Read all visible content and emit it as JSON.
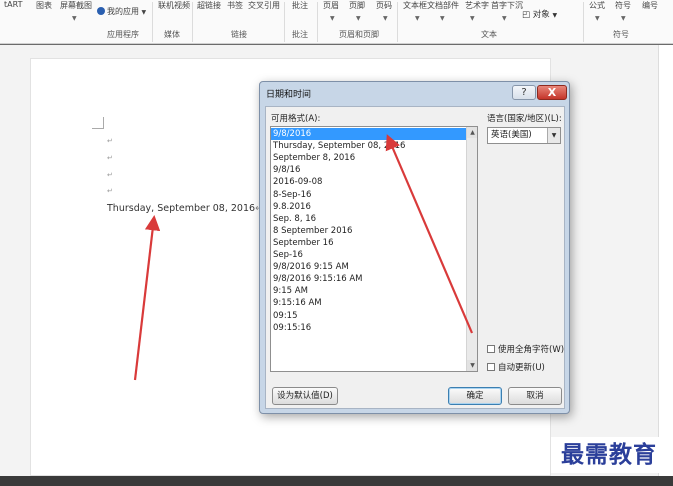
{
  "ribbon": {
    "top_items": [
      "tART",
      "图表",
      "屏幕截图",
      "我的应用",
      "联机视频",
      "超链接",
      "书签",
      "交叉引用",
      "批注",
      "页眉",
      "页脚",
      "页码",
      "文本框",
      "文档部件",
      "艺术字",
      "首字下沉",
      "公式",
      "符号",
      "编号"
    ],
    "object_label": "对象",
    "groups": [
      "应用程序",
      "媒体",
      "链接",
      "批注",
      "页眉和页脚",
      "文本",
      "符号"
    ]
  },
  "document": {
    "inserted_text": "Thursday, September 08, 2016"
  },
  "dialog": {
    "title": "日期和时间",
    "help_label": "?",
    "close_label": "X",
    "formats_label": "可用格式(A):",
    "formats": [
      "9/8/2016",
      "Thursday, September 08, 2016",
      "September 8, 2016",
      "9/8/16",
      "2016-09-08",
      "8-Sep-16",
      "9.8.2016",
      "Sep. 8, 16",
      "8 September 2016",
      "September 16",
      "Sep-16",
      "9/8/2016 9:15 AM",
      "9/8/2016 9:15:16 AM",
      "9:15 AM",
      "9:15:16 AM",
      "09:15",
      "09:15:16"
    ],
    "selected_index": 0,
    "language_label": "语言(国家/地区)(L):",
    "language_value": "英语(美国)",
    "fullwidth_label": "使用全角字符(W)",
    "autoupdate_label": "自动更新(U)",
    "set_default_label": "设为默认值(D)",
    "ok_label": "确定",
    "cancel_label": "取消"
  },
  "watermark": "最需教育",
  "colors": {
    "arrow": "#d93a3a",
    "selection": "#3399ff",
    "watermark": "#2b3f9a"
  }
}
